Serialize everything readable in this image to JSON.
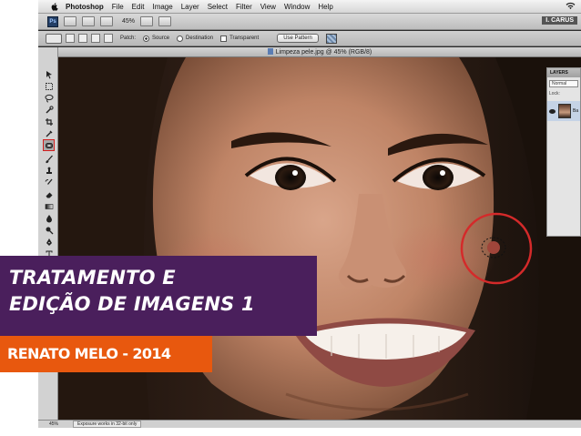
{
  "menubar": {
    "app_name": "Photoshop",
    "items": [
      "File",
      "Edit",
      "Image",
      "Layer",
      "Select",
      "Filter",
      "View",
      "Window",
      "Help"
    ],
    "user_label": "I. CARUS"
  },
  "appbar": {
    "logo": "Ps",
    "zoom": "45%"
  },
  "optionsbar": {
    "patch_label": "Patch:",
    "source_label": "Source",
    "destination_label": "Destination",
    "transparent_label": "Transparent",
    "use_pattern_label": "Use Pattern",
    "selected_mode": "Source"
  },
  "document": {
    "title": "Limpeza pele.jpg @ 45% (RGB/8)"
  },
  "tools": {
    "active_tool": "patch-tool",
    "icons": [
      "move-icon",
      "marquee-icon",
      "lasso-icon",
      "quick-select-icon",
      "crop-icon",
      "eyedropper-icon",
      "patch-icon",
      "brush-icon",
      "clone-stamp-icon",
      "history-brush-icon",
      "eraser-icon",
      "gradient-icon",
      "blur-icon",
      "dodge-icon",
      "pen-icon",
      "type-icon"
    ]
  },
  "layers_panel": {
    "tab": "LAYERS",
    "blend_mode": "Normal",
    "lock_label": "Lock:",
    "layer_name": "Ba"
  },
  "statusbar": {
    "zoom": "45%",
    "message": "Exposure works in 32-bit only"
  },
  "overlay": {
    "title_line1": "TRATAMENTO E",
    "title_line2": "EDIÇÃO DE IMAGENS 1",
    "author": "RENATO MELO - 2014"
  },
  "colors": {
    "title_banner": "#4a1f5c",
    "author_banner": "#e8580e",
    "highlight_circle": "#d42a2a"
  }
}
